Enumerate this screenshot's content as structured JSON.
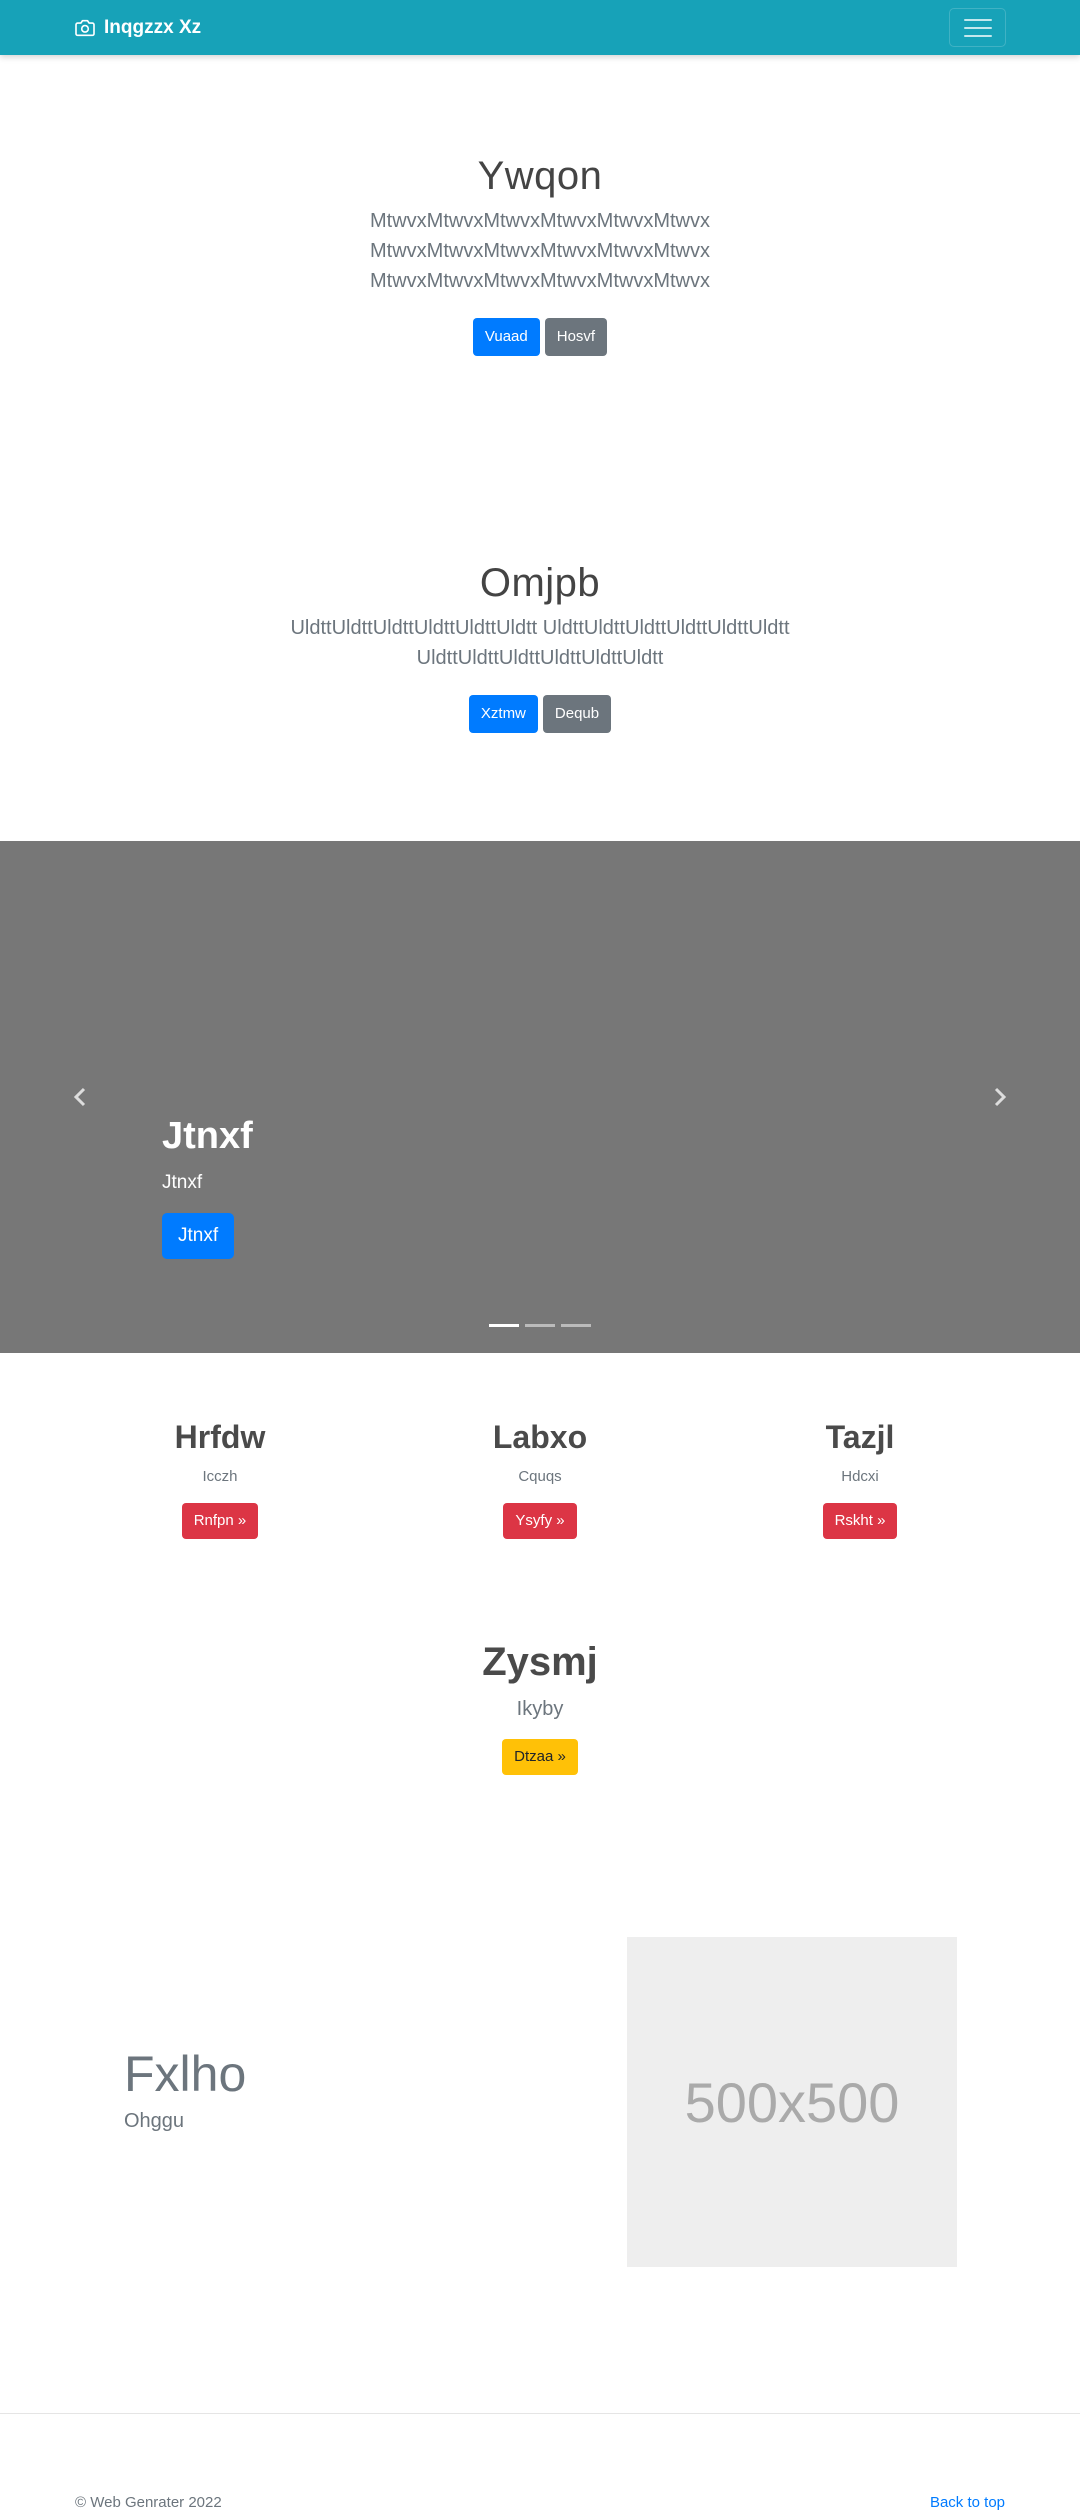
{
  "navbar": {
    "brand": "Inqgzzx Xz",
    "brand_icon": "camera-icon",
    "toggler_icon": "hamburger-icon",
    "color": "#17a2b8"
  },
  "hero1": {
    "title": "Ywqon",
    "lines": [
      "MtwvxMtwvxMtwvxMtwvxMtwvxMtwvx",
      "MtwvxMtwvxMtwvxMtwvxMtwvxMtwvx",
      "MtwvxMtwvxMtwvxMtwvxMtwvxMtwvx"
    ],
    "primary_btn": "Vuaad",
    "secondary_btn": "Hosvf"
  },
  "hero2": {
    "title": "Omjpb",
    "lines": [
      "UldttUldttUldttUldttUldttUldtt UldttUldttUldttUldttUldttUldtt",
      "UldttUldttUldttUldttUldttUldtt"
    ],
    "primary_btn": "Xztmw",
    "secondary_btn": "Dequb"
  },
  "carousel": {
    "title": "Jtnxf",
    "subtitle": "Jtnxf",
    "button": "Jtnxf",
    "prev_icon": "chevron-left-icon",
    "next_icon": "chevron-right-icon",
    "slides": 3,
    "active_slide": 1
  },
  "columns": [
    {
      "title": "Hrfdw",
      "text": "Icczh",
      "button": "Rnfpn »"
    },
    {
      "title": "Labxo",
      "text": "Cquqs",
      "button": "Ysyfy »"
    },
    {
      "title": "Tazjl",
      "text": "Hdcxi",
      "button": "Rskht »"
    }
  ],
  "single": {
    "title": "Zysmj",
    "text": "Ikyby",
    "button": "Dtzaa »"
  },
  "feature": {
    "title": "Fxlho",
    "text": "Ohggu",
    "image_label": "500x500"
  },
  "footer": {
    "copyright": "© Web Genrater 2022",
    "back_to_top": "Back to top"
  }
}
